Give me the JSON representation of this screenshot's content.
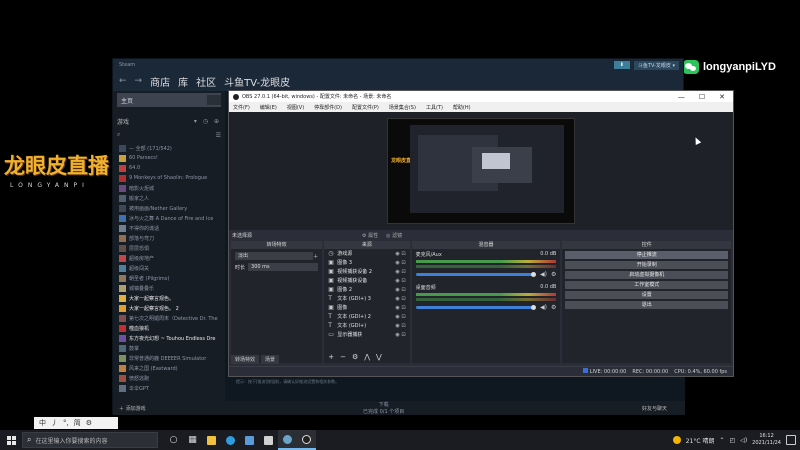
{
  "overlay": {
    "logo_main": "龙眼皮直播",
    "logo_sub": "LONGYANPI",
    "wechat_id": "longyanpiLYD"
  },
  "steam": {
    "menu_label": "Steam",
    "nav": [
      "商店",
      "库",
      "社区",
      "斗鱼TV-龙眼皮"
    ],
    "top_button": "",
    "home_label": "主页",
    "games_label": "游戏",
    "games": [
      {
        "name": "— 全部 (171/542)",
        "style": "header",
        "color": "#3a4a5c"
      },
      {
        "name": "60 Parsecs!",
        "style": "",
        "color": "#c8a040"
      },
      {
        "name": "64.0",
        "style": "",
        "color": "#c04040"
      },
      {
        "name": "9 Monkeys of Shaolin: Prologue",
        "style": "",
        "color": "#b03030"
      },
      {
        "name": "暗影火炬城",
        "style": "",
        "color": "#6a4a80"
      },
      {
        "name": "搬家之人",
        "style": "",
        "color": "#506070"
      },
      {
        "name": "被用画画/Nether Gallery",
        "style": "",
        "color": "#404858"
      },
      {
        "name": "冰与火之舞 A Dance of Fire and Ice",
        "style": "",
        "color": "#4070b0"
      },
      {
        "name": "不得你的谎话",
        "style": "",
        "color": "#708090"
      },
      {
        "name": "部落与弯刀",
        "style": "",
        "color": "#907050"
      },
      {
        "name": "层层恐惧",
        "style": "",
        "color": "#605048"
      },
      {
        "name": "超级房地产",
        "style": "",
        "color": "#c04848"
      },
      {
        "name": "超级闯关",
        "style": "",
        "color": "#5080a0"
      },
      {
        "name": "朝圣者 (Pilgrims)",
        "style": "",
        "color": "#907858"
      },
      {
        "name": "城镇叠叠乐",
        "style": "",
        "color": "#b0a070"
      },
      {
        "name": "大家一起察言观色。",
        "style": "bright",
        "color": "#e0b040"
      },
      {
        "name": "大家一起察言观色。 2",
        "style": "bright",
        "color": "#e0a030"
      },
      {
        "name": "第七次之明媚周末（Detective Dr. The",
        "style": "",
        "color": "#805050"
      },
      {
        "name": "噬血狼机",
        "style": "bright",
        "color": "#c03030"
      },
      {
        "name": "东方夜光幻想 ~ Touhou Endless Dre",
        "style": "bright",
        "color": "#7050a0"
      },
      {
        "name": "鼓掌",
        "style": "",
        "color": "#506878"
      },
      {
        "name": "非常普通的鹿 DEEEER Simulator",
        "style": "",
        "color": "#809060"
      },
      {
        "name": "风来之国 (Eastward)",
        "style": "",
        "color": "#c08040"
      },
      {
        "name": "愤怒逃跑",
        "style": "",
        "color": "#a05040"
      },
      {
        "name": "伞伞GPT",
        "style": "",
        "color": "#607080"
      }
    ],
    "add_game": "添加游戏",
    "download_label": "下载",
    "download_sub": "已完成 0/1 个项目",
    "friends_label": "好友与聊天"
  },
  "obs": {
    "title": "OBS 27.0.1 (64-bit, windows) - 配置文件: 未命名 - 场景: 未命名",
    "window_controls": [
      "—",
      "☐",
      "✕"
    ],
    "menu": [
      "文件(F)",
      "编辑(E)",
      "视图(V)",
      "停靠部件(D)",
      "配置文件(P)",
      "场景集合(S)",
      "工具(T)",
      "帮助(H)"
    ],
    "preview_logo": "龙眼皮直播",
    "scene_label": "未选择源",
    "rec_buttons": [
      "属性",
      "滤镜"
    ],
    "dock_transitions": "转场特效",
    "transition_value": "淡出",
    "duration_label": "时长",
    "duration_value": "300 ms",
    "dock_sources": "来源",
    "sources": [
      {
        "icon": "◷",
        "name": "游戏源"
      },
      {
        "icon": "▣",
        "name": "图像 3"
      },
      {
        "icon": "▣",
        "name": "视频捕获设备 2"
      },
      {
        "icon": "▣",
        "name": "视频捕获设备"
      },
      {
        "icon": "▣",
        "name": "图像 2"
      },
      {
        "icon": "T",
        "name": "文本 (GDI+) 3"
      },
      {
        "icon": "▣",
        "name": "图像"
      },
      {
        "icon": "T",
        "name": "文本 (GDI+) 2"
      },
      {
        "icon": "T",
        "name": "文本 (GDI+)"
      },
      {
        "icon": "▭",
        "name": "显示器捕获"
      }
    ],
    "source_tools": [
      "+",
      "−",
      "⚙",
      "⋀",
      "⋁"
    ],
    "dock_mixer": "混音器",
    "mixer": [
      {
        "name": "麦克风/Aux",
        "level": "0.0 dB"
      },
      {
        "name": "桌面音频",
        "level": "0.0 dB"
      }
    ],
    "dock_controls": "控件",
    "controls": [
      "停止推流",
      "开始录制",
      "启动虚拟摄像机",
      "工作室模式",
      "设置",
      "退出"
    ],
    "dock_tabs": [
      "转场特效",
      "场景"
    ],
    "status": {
      "live": "LIVE: 00:00:00",
      "rec": "REC: 00:00:00",
      "cpu": "CPU: 0.4%, 60.00 fps"
    },
    "notice": "提示：按下[推流]按钮前，请确认好推流设置和相关参数。"
  },
  "ime": [
    "中",
    "丿",
    "°,",
    "简",
    "⚙"
  ],
  "taskbar": {
    "search_placeholder": "在这里输入你要搜索的内容",
    "weather": "21°C 晴朗",
    "time": "16:12",
    "date": "2021/11/24"
  },
  "colors": {
    "logo_gold": "#f0b030",
    "wechat_green": "#2bc35a",
    "steam_bg": "#1b2838",
    "obs_bg": "#2b2e38"
  }
}
